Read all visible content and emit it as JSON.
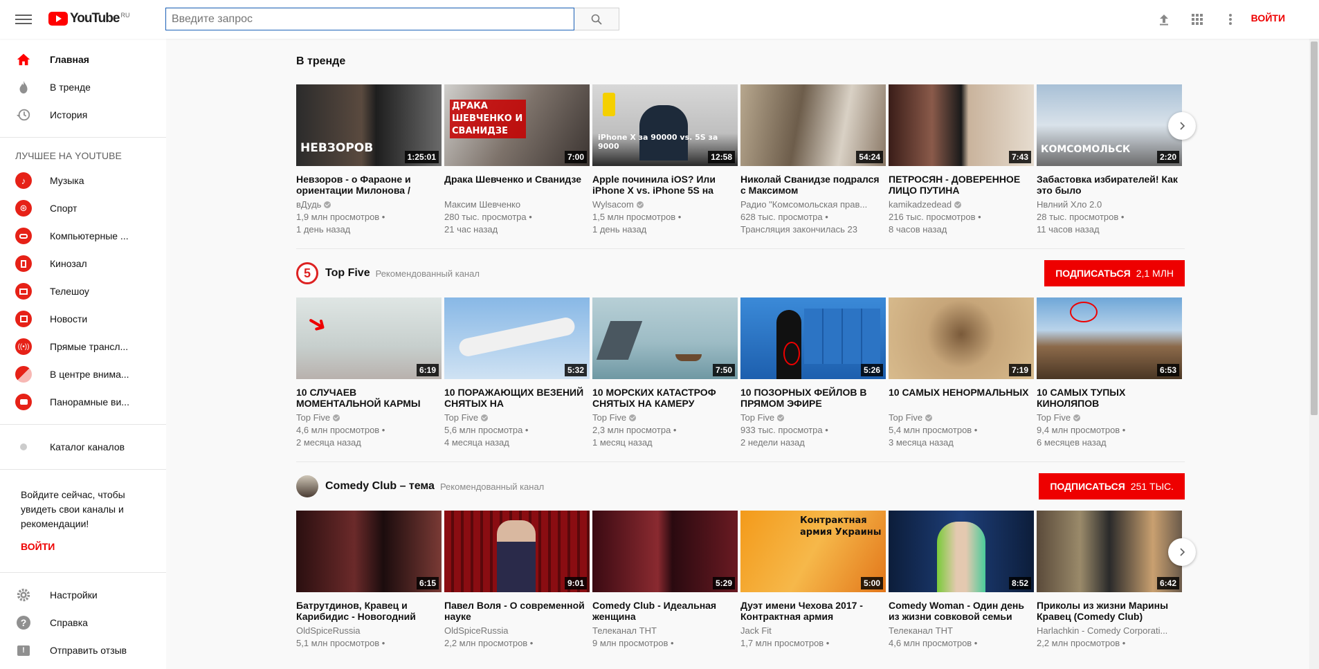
{
  "header": {
    "logo_text": "YouTube",
    "logo_region": "RU",
    "search_placeholder": "Введите запрос",
    "signin_label": "ВОЙТИ"
  },
  "sidebar": {
    "main_items": [
      {
        "label": "Главная",
        "icon": "home-icon"
      },
      {
        "label": "В тренде",
        "icon": "flame-icon"
      },
      {
        "label": "История",
        "icon": "history-icon"
      }
    ],
    "best_heading": "ЛУЧШЕЕ НА YOUTUBE",
    "best_items": [
      {
        "label": "Музыка",
        "icon": "music-icon"
      },
      {
        "label": "Спорт",
        "icon": "sport-icon"
      },
      {
        "label": "Компьютерные ...",
        "icon": "gaming-icon"
      },
      {
        "label": "Кинозал",
        "icon": "movies-icon"
      },
      {
        "label": "Телешоу",
        "icon": "tv-icon"
      },
      {
        "label": "Новости",
        "icon": "news-icon"
      },
      {
        "label": "Прямые трансл...",
        "icon": "live-icon"
      },
      {
        "label": "В центре внима...",
        "icon": "spotlight-icon"
      },
      {
        "label": "Панорамные ви...",
        "icon": "360-icon"
      }
    ],
    "catalog_label": "Каталог каналов",
    "login_prompt": "Войдите сейчас, чтобы увидеть свои каналы и рекомендации!",
    "login_button": "ВОЙТИ",
    "bottom_items": [
      {
        "label": "Настройки",
        "icon": "gear-icon"
      },
      {
        "label": "Справка",
        "icon": "help-icon"
      },
      {
        "label": "Отправить отзыв",
        "icon": "feedback-icon"
      }
    ]
  },
  "shelves": {
    "trending": {
      "title": "В тренде",
      "videos": [
        {
          "title": "Невзоров - о Фараоне и ориентации Милонова /",
          "channel": "вДудь",
          "verified": true,
          "views": "1,9 млн просмотров •",
          "age": "1 день назад",
          "duration": "1:25:01"
        },
        {
          "title": "Драка Шевченко и Сванидзе",
          "channel": "Максим Шевченко",
          "verified": false,
          "views": "280 тыс. просмотра •",
          "age": "21 час назад",
          "duration": "7:00"
        },
        {
          "title": "Apple починила iOS? Или iPhone X vs. iPhone 5S на",
          "channel": "Wylsacom",
          "verified": true,
          "views": "1,5 млн просмотров •",
          "age": "1 день назад",
          "duration": "12:58"
        },
        {
          "title": "Николай Сванидзе подрался с Максимом",
          "channel": "Радио \"Комсомольская прав...",
          "verified": false,
          "views": "628 тыс. просмотра •",
          "age": "Трансляция закончилась 23",
          "duration": "54:24"
        },
        {
          "title": "ПЕТРОСЯН - ДОВЕРЕННОЕ ЛИЦО ПУТИНА",
          "channel": "kamikadzedead",
          "verified": true,
          "views": "216 тыс. просмотров •",
          "age": "8 часов назад",
          "duration": "7:43"
        },
        {
          "title": "Забастовка избирателей! Как это было",
          "channel": "Нвлний Хло 2.0",
          "verified": false,
          "views": "28 тыс. просмотров •",
          "age": "11 часов назад",
          "duration": "2:20"
        }
      ],
      "thumb_text": [
        "НЕВЗОРОВ",
        "ДРАКА ШЕВЧЕНКО И СВАНИДЗЕ",
        "iPhone X за 90000 vs. 5S за 9000",
        "",
        "",
        "КОМСОМОЛЬСК"
      ]
    },
    "topfive": {
      "title": "Top Five",
      "subtitle": "Рекомендованный канал",
      "subscribe_label": "ПОДПИСАТЬСЯ",
      "subscribe_count": "2,1 МЛН",
      "videos": [
        {
          "title": "10 СЛУЧАЕВ МОМЕНТАЛЬНОЙ КАРМЫ",
          "channel": "Top Five",
          "verified": true,
          "views": "4,6 млн просмотров •",
          "age": "2 месяца назад",
          "duration": "6:19"
        },
        {
          "title": "10 ПОРАЖАЮЩИХ ВЕЗЕНИЙ СНЯТЫХ НА",
          "channel": "Top Five",
          "verified": true,
          "views": "5,6 млн просмотра •",
          "age": "4 месяца назад",
          "duration": "5:32"
        },
        {
          "title": "10 МОРСКИХ КАТАСТРОФ СНЯТЫХ НА КАМЕРУ",
          "channel": "Top Five",
          "verified": true,
          "views": "2,3 млн просмотра •",
          "age": "1 месяц назад",
          "duration": "7:50"
        },
        {
          "title": "10 ПОЗОРНЫХ ФЕЙЛОВ В ПРЯМОМ ЭФИРЕ",
          "channel": "Top Five",
          "verified": true,
          "views": "933 тыс. просмотра •",
          "age": "2 недели назад",
          "duration": "5:26"
        },
        {
          "title": "10 САМЫХ НЕНОРМАЛЬНЫХ",
          "channel": "Top Five",
          "verified": true,
          "views": "5,4 млн просмотров •",
          "age": "3 месяца назад",
          "duration": "7:19"
        },
        {
          "title": "10 САМЫХ ТУПЫХ КИНОЛЯПОВ",
          "channel": "Top Five",
          "verified": true,
          "views": "9,4 млн просмотров •",
          "age": "6 месяцев назад",
          "duration": "6:53"
        }
      ]
    },
    "comedy": {
      "title": "Comedy Club – тема",
      "subtitle": "Рекомендованный канал",
      "subscribe_label": "ПОДПИСАТЬСЯ",
      "subscribe_count": "251 ТЫС.",
      "videos": [
        {
          "title": "Батрутдинов, Кравец и Карибидис - Новогодний",
          "channel": "OldSpiceRussia",
          "verified": false,
          "views": "5,1 млн просмотров •",
          "age": "",
          "duration": "6:15"
        },
        {
          "title": "Павел Воля - О современной науке",
          "channel": "OldSpiceRussia",
          "verified": false,
          "views": "2,2 млн просмотров •",
          "age": "",
          "duration": "9:01"
        },
        {
          "title": "Comedy Club - Идеальная женщина",
          "channel": "Телеканал ТНТ",
          "verified": false,
          "views": "9 млн просмотров •",
          "age": "",
          "duration": "5:29"
        },
        {
          "title": "Дуэт имени Чехова 2017 - Контрактная армия",
          "channel": "Jack Fit",
          "verified": false,
          "views": "1,7 млн просмотров •",
          "age": "",
          "duration": "5:00"
        },
        {
          "title": "Comedy Woman - Один день из жизни совковой семьи",
          "channel": "Телеканал ТНТ",
          "verified": false,
          "views": "4,6 млн просмотров •",
          "age": "",
          "duration": "8:52"
        },
        {
          "title": "Приколы из жизни Марины Кравец (Comedy Club)",
          "channel": "Harlachkin - Comedy Corporati...",
          "verified": false,
          "views": "2,2 млн просмотров •",
          "age": "",
          "duration": "6:42"
        }
      ],
      "thumb_text": [
        "",
        "",
        "",
        "Контрактная армия Украины",
        "",
        ""
      ]
    }
  },
  "colors": {
    "accent": "#ff0000",
    "subscribe": "#e00000"
  }
}
